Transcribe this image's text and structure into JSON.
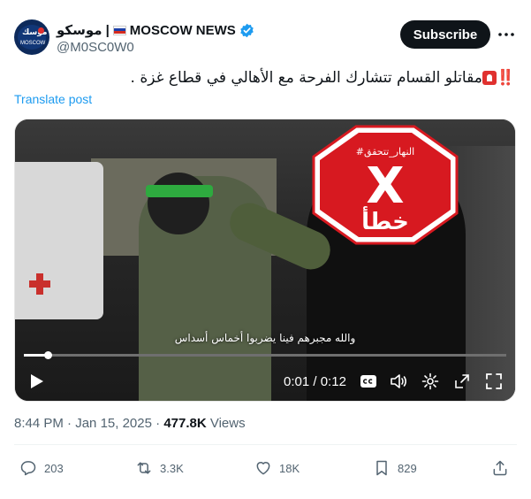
{
  "author": {
    "display_name_ar": "موسكو",
    "separator": "|",
    "display_name_en": "MOSCOW NEWS",
    "handle": "@M0SC0W0",
    "avatar_top": "موسك",
    "avatar_bottom": "MOSCOW"
  },
  "header": {
    "subscribe_label": "Subscribe"
  },
  "post": {
    "text": "مقاتلو القسام تتشارك الفرحة مع الأهالي في قطاع غزة .",
    "prefix_marks": "‼️",
    "translate_label": "Translate post"
  },
  "media": {
    "stamp_tag": "#النهار_تتحقق",
    "stamp_letter": "X",
    "stamp_word": "خطأ",
    "subtitle": "والله مجبرهم فينا يضربوا أخماس أسداس",
    "time_current": "0:01",
    "time_separator": "/",
    "time_total": "0:12",
    "progress_fraction": 0.05
  },
  "meta": {
    "time": "8:44 PM",
    "dot1": "·",
    "date": "Jan 15, 2025",
    "dot2": "·",
    "views_count": "477.8K",
    "views_label": "Views"
  },
  "actions": {
    "replies": "203",
    "reposts": "3.3K",
    "likes": "18K",
    "bookmarks": "829"
  },
  "colors": {
    "stamp_red": "#d71920",
    "link_blue": "#1d9bf0",
    "verified_blue": "#1d9bf0"
  }
}
